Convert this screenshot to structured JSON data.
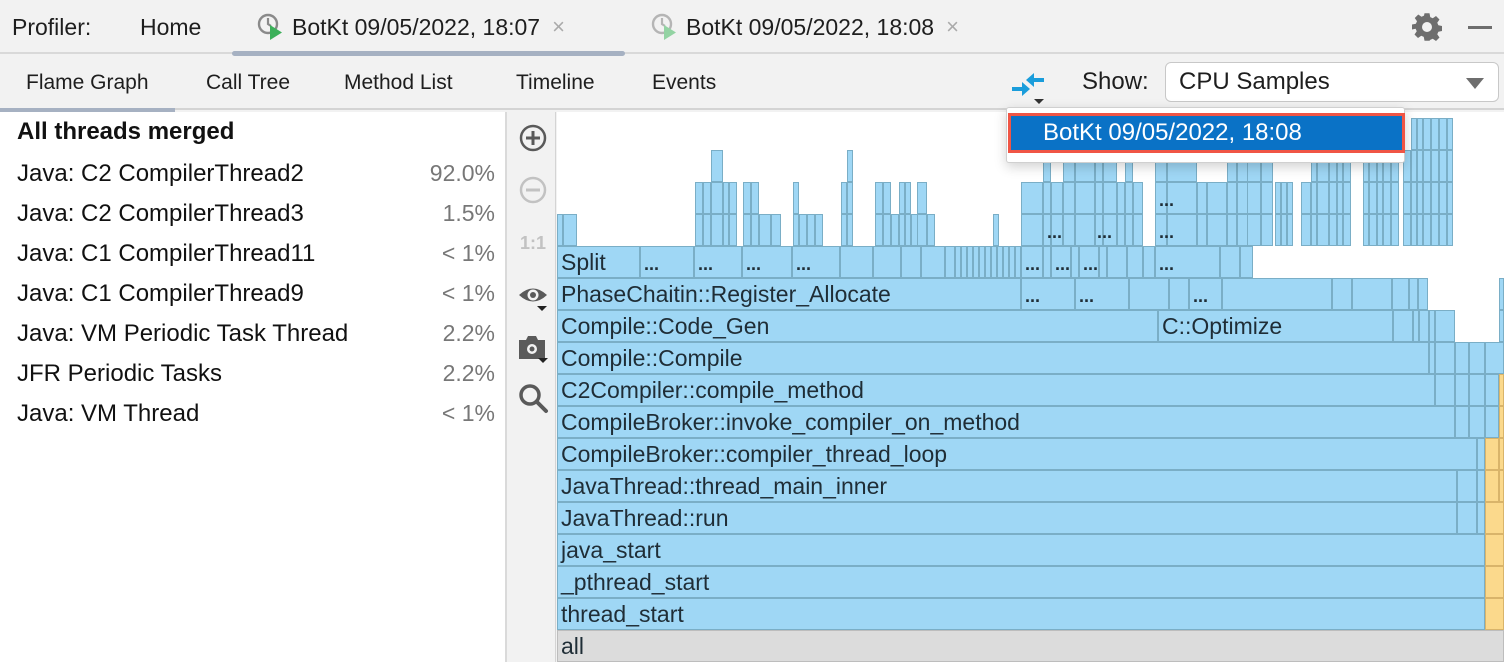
{
  "topbar": {
    "profiler_label": "Profiler:",
    "home_label": "Home",
    "tabs": [
      {
        "label": "BotKt 09/05/2022, 18:07",
        "active": true,
        "icon": "profiler-snapshot-icon"
      },
      {
        "label": "BotKt 09/05/2022, 18:08",
        "active": false,
        "icon": "profiler-snapshot-icon"
      }
    ],
    "close_glyph": "×",
    "settings_icon": "gear-icon",
    "minimize_icon": "minimize-icon"
  },
  "subbar": {
    "tabs": [
      {
        "label": "Flame Graph",
        "active": true
      },
      {
        "label": "Call Tree",
        "active": false
      },
      {
        "label": "Method List",
        "active": false
      },
      {
        "label": "Timeline",
        "active": false
      },
      {
        "label": "Events",
        "active": false
      }
    ],
    "compare_icon": "compare-snapshots-icon",
    "show_label": "Show:",
    "show_value": "CPU Samples"
  },
  "popup": {
    "items": [
      {
        "label": "BotKt 09/05/2022, 18:08",
        "selected": true
      }
    ]
  },
  "threads": {
    "header": "All threads merged",
    "items": [
      {
        "name": "Java: C2 CompilerThread2",
        "percent": "92.0%"
      },
      {
        "name": "Java: C2 CompilerThread3",
        "percent": "1.5%"
      },
      {
        "name": "Java: C1 CompilerThread11",
        "percent": "< 1%"
      },
      {
        "name": "Java: C1 CompilerThread9",
        "percent": "< 1%"
      },
      {
        "name": "Java: VM Periodic Task Thread",
        "percent": "2.2%"
      },
      {
        "name": "JFR Periodic Tasks",
        "percent": "2.2%"
      },
      {
        "name": "Java: VM Thread",
        "percent": "< 1%"
      }
    ]
  },
  "tools": [
    {
      "name": "zoom-in-icon",
      "enabled": true
    },
    {
      "name": "zoom-out-icon",
      "enabled": false
    },
    {
      "name": "actual-size-icon",
      "label": "1:1",
      "enabled": false
    },
    {
      "name": "eye-icon",
      "enabled": true
    },
    {
      "name": "camera-icon",
      "enabled": true
    },
    {
      "name": "search-icon",
      "enabled": true
    }
  ],
  "flame": {
    "colors": {
      "frame": "#9fd7f5",
      "frame_border": "#7aaec6",
      "native": "#fbd98c",
      "native_border": "#d9b46a",
      "root": "#dcdcdc"
    },
    "root_label": "all",
    "stack_labels": [
      "thread_start",
      "_pthread_start",
      "java_start",
      "JavaThread::run",
      "JavaThread::thread_main_inner",
      "CompileBroker::compiler_thread_loop",
      "CompileBroker::invoke_compiler_on_method",
      "C2Compiler::compile_method",
      "Compile::Compile",
      "Compile::Code_Gen",
      "PhaseChaitin::Register_Allocate",
      "Split"
    ],
    "secondary_labels": {
      "optimize": "C::Optimize"
    },
    "ellipsis": "..."
  }
}
